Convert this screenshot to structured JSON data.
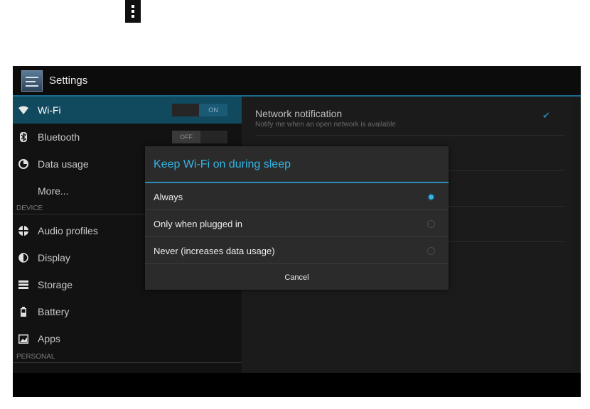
{
  "toolbar": {
    "overflow_icon": "overflow-menu-icon"
  },
  "actionbar": {
    "title": "Settings",
    "icon": "settings-app-icon"
  },
  "sidebar": {
    "items": [
      {
        "label": "Wi-Fi",
        "icon": "wifi-icon",
        "toggle": "ON"
      },
      {
        "label": "Bluetooth",
        "icon": "bluetooth-icon",
        "toggle": "OFF"
      },
      {
        "label": "Data usage",
        "icon": "data-usage-icon"
      },
      {
        "label": "More..."
      }
    ],
    "device_header": "DEVICE",
    "device_items": [
      {
        "label": "Audio profiles",
        "icon": "audio-profiles-icon"
      },
      {
        "label": "Display",
        "icon": "display-icon"
      },
      {
        "label": "Storage",
        "icon": "storage-icon"
      },
      {
        "label": "Battery",
        "icon": "battery-icon"
      },
      {
        "label": "Apps",
        "icon": "apps-icon"
      }
    ],
    "personal_header": "PERSONAL"
  },
  "detail": {
    "network_notification": {
      "title": "Network notification",
      "summary": "Notify me when an open network is available",
      "checked": true
    }
  },
  "dialog": {
    "title": "Keep Wi-Fi on during sleep",
    "options": [
      {
        "label": "Always",
        "selected": true
      },
      {
        "label": "Only when plugged in",
        "selected": false
      },
      {
        "label": "Never (increases data usage)",
        "selected": false
      }
    ],
    "cancel_label": "Cancel"
  },
  "colors": {
    "accent": "#34b5e5",
    "selection": "#11495f"
  }
}
